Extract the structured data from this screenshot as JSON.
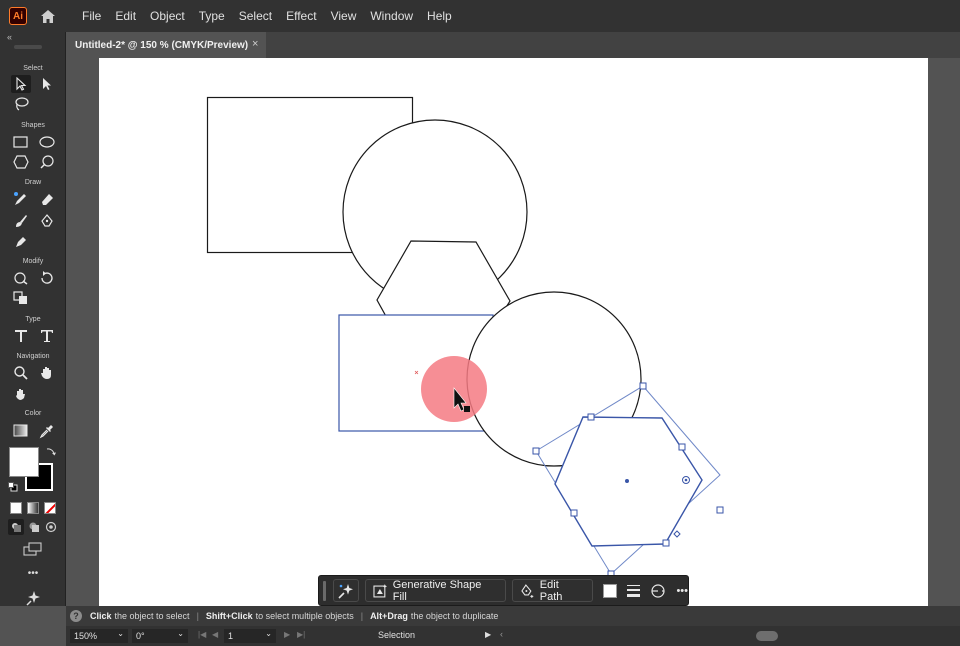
{
  "app": {
    "logo_text": "Ai"
  },
  "menu": [
    "File",
    "Edit",
    "Object",
    "Type",
    "Select",
    "Effect",
    "View",
    "Window",
    "Help"
  ],
  "tab": {
    "title": "Untitled-2* @ 150 % (CMYK/Preview)",
    "close": "×"
  },
  "toolbar": {
    "collapse": "«",
    "sections": {
      "select": "Select",
      "shapes": "Shapes",
      "draw": "Draw",
      "modify": "Modify",
      "type": "Type",
      "navigation": "Navigation",
      "color": "Color"
    },
    "more": "•••"
  },
  "context_bar": {
    "generative_label": "Generative Shape Fill",
    "edit_path_label": "Edit Path",
    "more": "•••"
  },
  "hint": {
    "icon": "?",
    "p1_strong": "Click",
    "p1": "the object to select",
    "p2_strong": "Shift+Click",
    "p2": "to select multiple objects",
    "p3_strong": "Alt+Drag",
    "p3": "the object to duplicate",
    "sep": "|"
  },
  "status": {
    "zoom": "150%",
    "rotation": "0°",
    "artboard": "1",
    "tool": "Selection"
  },
  "colors": {
    "selection": "#3a56a8",
    "cursor_highlight": "#f47a82",
    "accent": "#ff7c2a"
  }
}
